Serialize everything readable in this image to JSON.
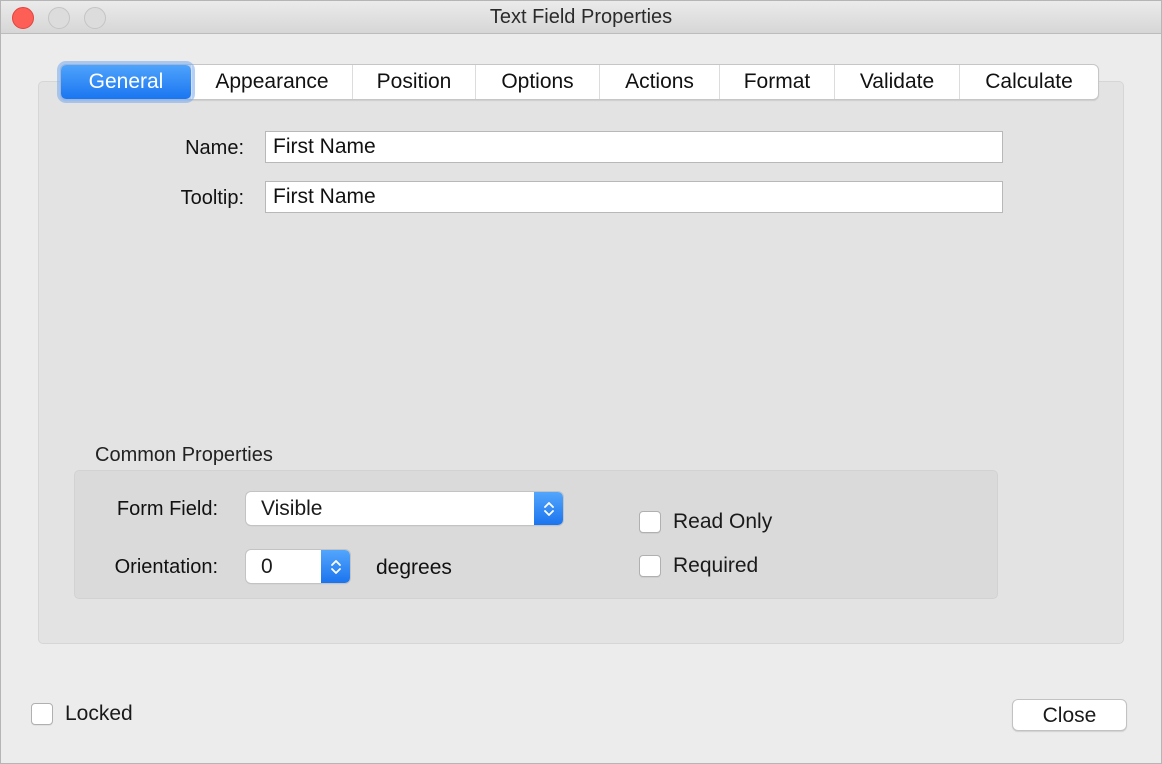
{
  "window": {
    "title": "Text Field Properties"
  },
  "tabs": [
    {
      "label": "General",
      "active": true
    },
    {
      "label": "Appearance",
      "active": false
    },
    {
      "label": "Position",
      "active": false
    },
    {
      "label": "Options",
      "active": false
    },
    {
      "label": "Actions",
      "active": false
    },
    {
      "label": "Format",
      "active": false
    },
    {
      "label": "Validate",
      "active": false
    },
    {
      "label": "Calculate",
      "active": false
    }
  ],
  "general": {
    "name_label": "Name:",
    "name_value": "First Name",
    "tooltip_label": "Tooltip:",
    "tooltip_value": "First Name"
  },
  "common_properties": {
    "title": "Common Properties",
    "form_field_label": "Form Field:",
    "form_field_value": "Visible",
    "orientation_label": "Orientation:",
    "orientation_value": "0",
    "orientation_unit": "degrees",
    "read_only_label": "Read Only",
    "read_only_checked": false,
    "required_label": "Required",
    "required_checked": false
  },
  "footer": {
    "locked_label": "Locked",
    "locked_checked": false,
    "close_label": "Close"
  },
  "colors": {
    "accent": "#1a76f1",
    "close_traffic": "#fd5f57"
  }
}
